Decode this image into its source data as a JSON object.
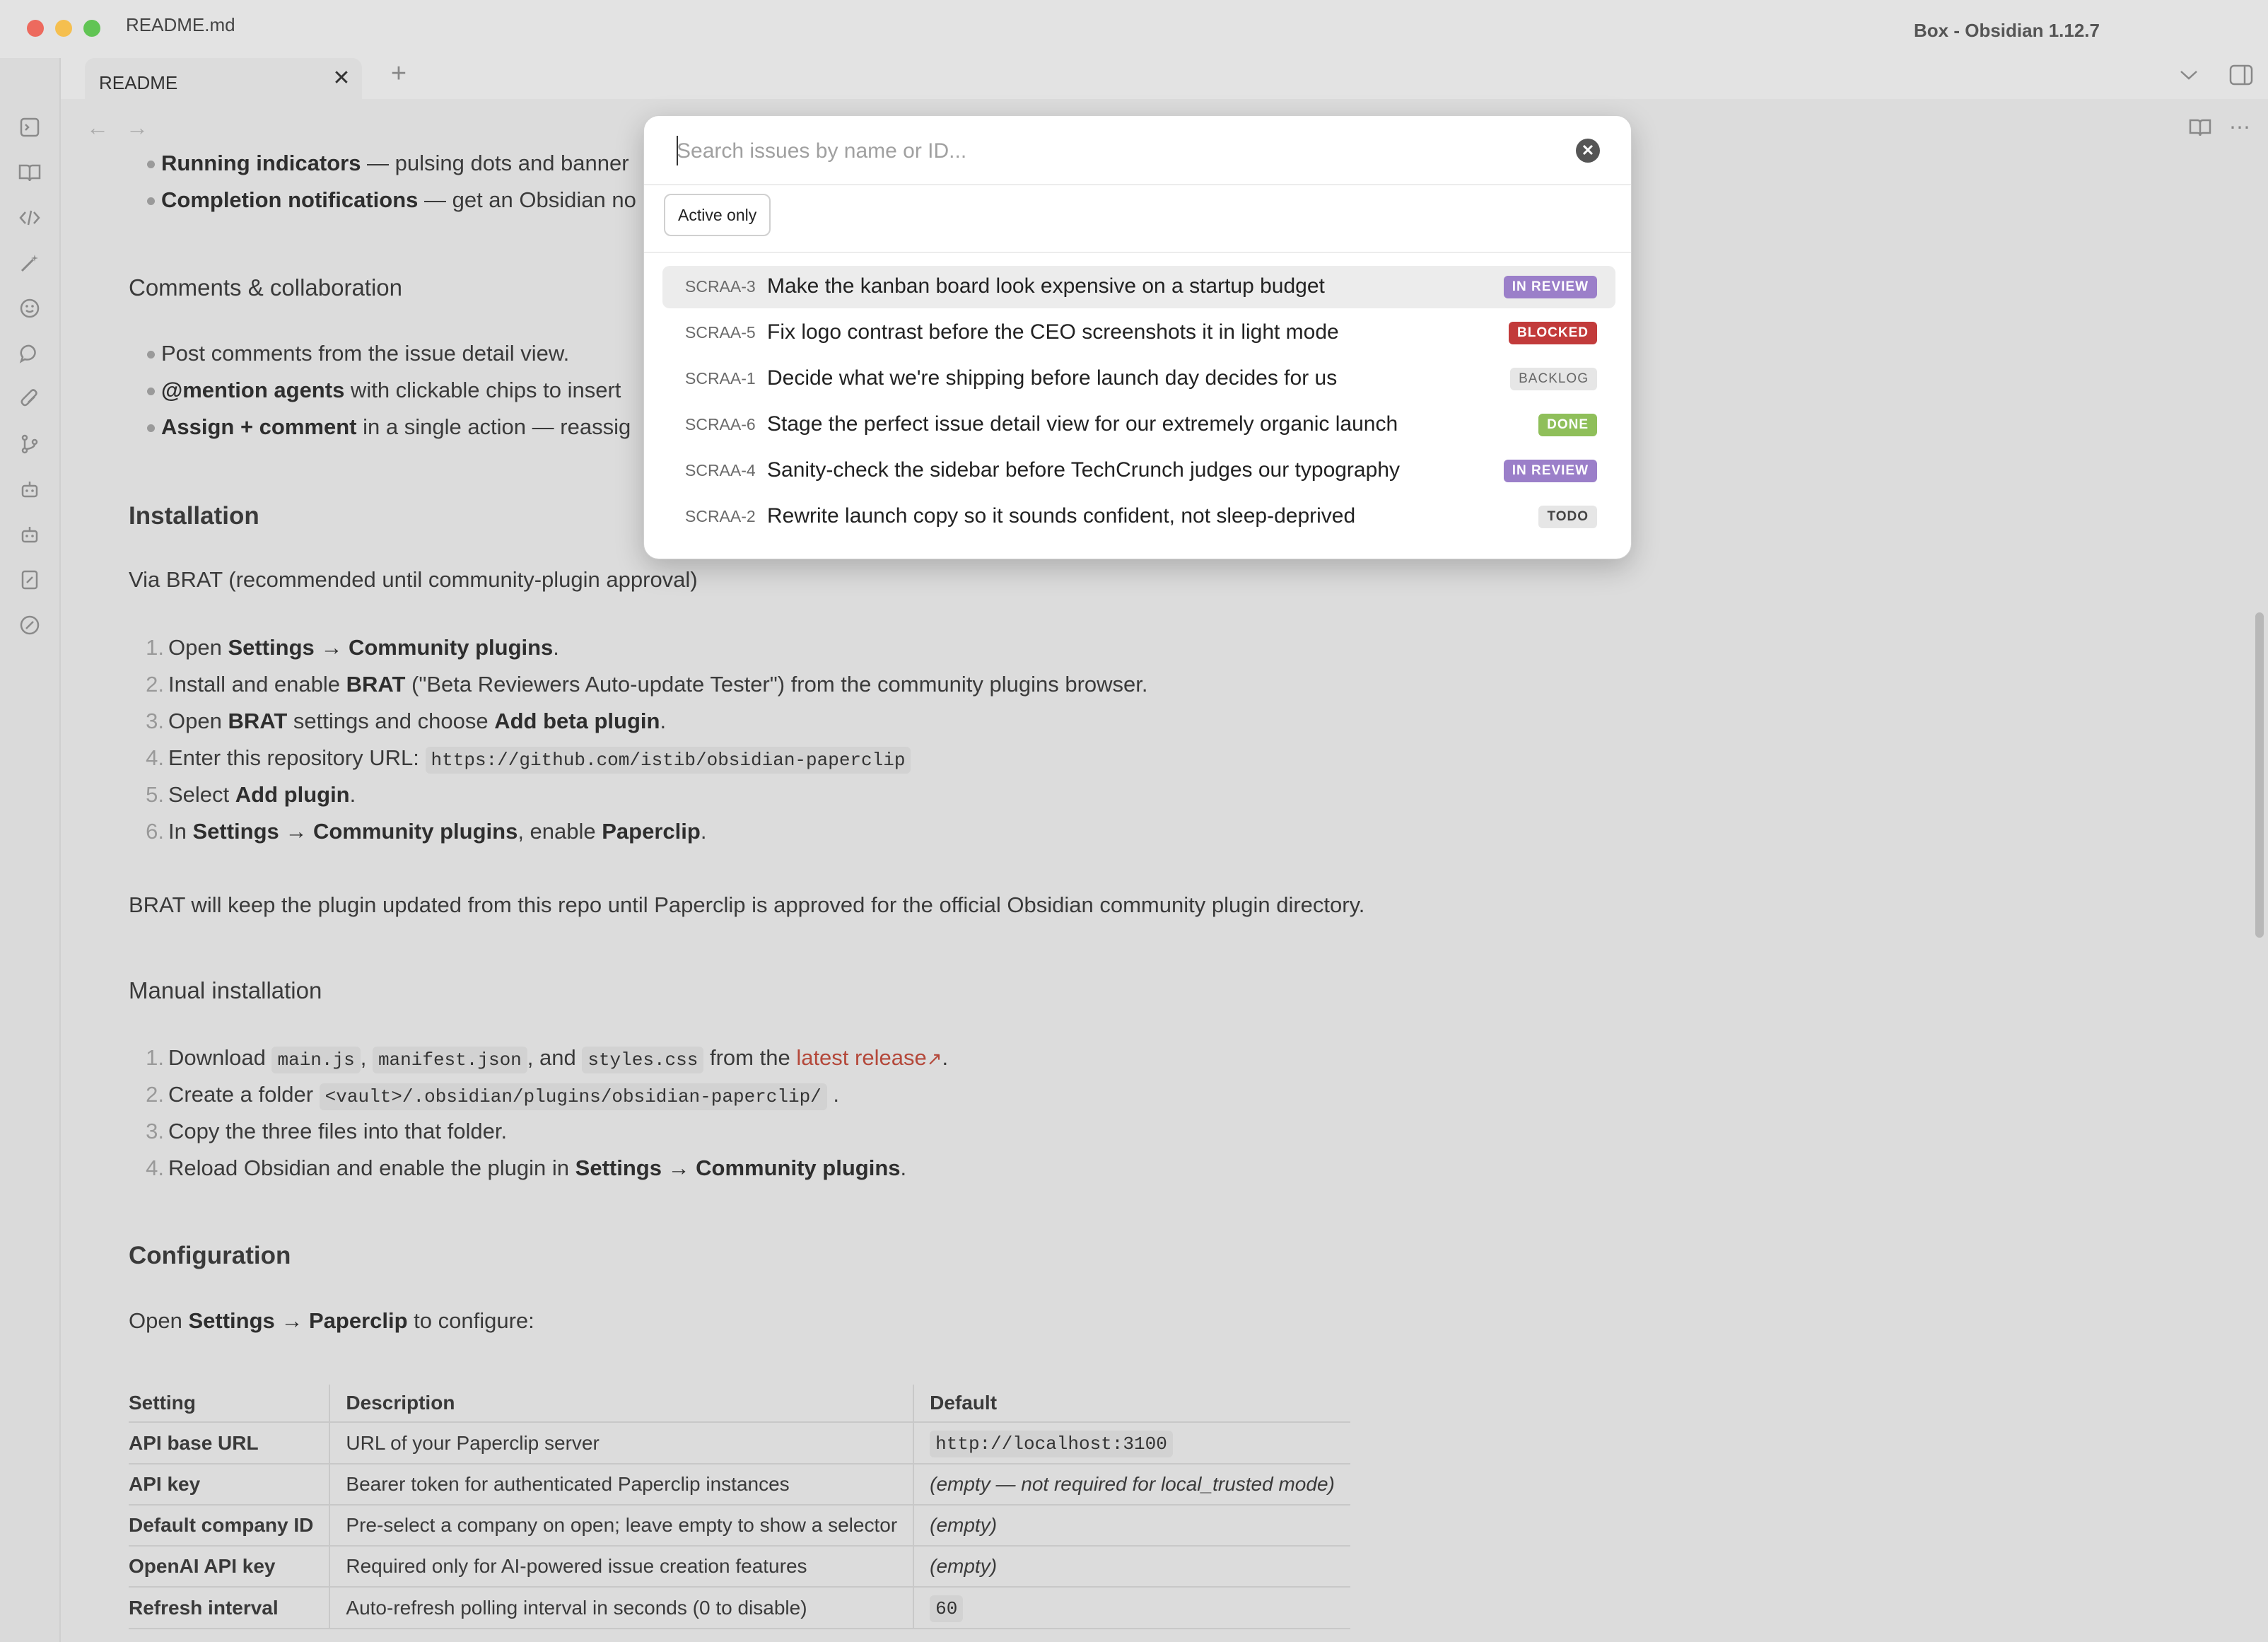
{
  "window": {
    "file_title": "README.md",
    "app_title": "Box - Obsidian 1.12.7"
  },
  "tab": {
    "label": "README",
    "close": "✕",
    "new": "+"
  },
  "doc": {
    "l1_bold": "Running indicators",
    "l1_rest": " — pulsing dots and banner",
    "l2_bold": "Completion notifications",
    "l2_rest": " — get an Obsidian no",
    "h_comments": "Comments & collaboration",
    "c1": "Post comments from the issue detail view.",
    "c2_bold": "@mention agents",
    "c2_rest": " with clickable chips to insert",
    "c3_bold": "Assign + comment",
    "c3_rest": " in a single action — reassig",
    "h_install": "Installation",
    "via_brat": "Via BRAT (recommended until community-plugin approval)",
    "s1_a": "Open ",
    "s1_b": "Settings → Community plugins",
    "s1_c": ".",
    "s2_a": "Install and enable ",
    "s2_b": "BRAT",
    "s2_c": " (\"Beta Reviewers Auto-update Tester\") from the community plugins browser.",
    "s3_a": "Open ",
    "s3_b": "BRAT",
    "s3_c": " settings and choose ",
    "s3_d": "Add beta plugin",
    "s3_e": ".",
    "s4_a": "Enter this repository URL: ",
    "s4_code": "https://github.com/istib/obsidian-paperclip",
    "s5_a": "Select ",
    "s5_b": "Add plugin",
    "s5_c": ".",
    "s6_a": "In ",
    "s6_b": "Settings → Community plugins",
    "s6_c": ", enable ",
    "s6_d": "Paperclip",
    "s6_e": ".",
    "brat_note": "BRAT will keep the plugin updated from this repo until Paperclip is approved for the official Obsidian community plugin directory.",
    "h_manual": "Manual installation",
    "m1_a": "Download ",
    "m1_c1": "main.js",
    "m1_s1": ", ",
    "m1_c2": "manifest.json",
    "m1_s2": ", and ",
    "m1_c3": "styles.css",
    "m1_s3": " from the ",
    "m1_link": "latest release",
    "m1_end": ".",
    "m2_a": "Create a folder ",
    "m2_code": "<vault>/.obsidian/plugins/obsidian-paperclip/",
    "m2_end": ".",
    "m3": "Copy the three files into that folder.",
    "m4_a": "Reload Obsidian and enable the plugin in ",
    "m4_b": "Settings → Community plugins",
    "m4_c": ".",
    "h_config": "Configuration",
    "cfg_a": "Open ",
    "cfg_b": "Settings → Paperclip",
    "cfg_c": " to configure:"
  },
  "numbers": [
    "1.",
    "2.",
    "3.",
    "4.",
    "5.",
    "6."
  ],
  "table": {
    "headers": [
      "Setting",
      "Description",
      "Default"
    ],
    "rows": [
      [
        "API base URL",
        "URL of your Paperclip server",
        "http://localhost:3100"
      ],
      [
        "API key",
        "Bearer token for authenticated Paperclip instances",
        "(empty — not required for local_trusted mode)"
      ],
      [
        "Default company ID",
        "Pre-select a company on open; leave empty to show a selector",
        "(empty)"
      ],
      [
        "OpenAI API key",
        "Required only for AI-powered issue creation features",
        "(empty)"
      ],
      [
        "Refresh interval",
        "Auto-refresh polling interval in seconds (0 to disable)",
        "60"
      ]
    ]
  },
  "modal": {
    "search_placeholder": "Search issues by name or ID...",
    "search_value": "",
    "filter_label": "Active only",
    "issues": [
      {
        "id": "SCRAA-3",
        "title": "Make the kanban board look expensive on a startup budget",
        "status": "IN REVIEW"
      },
      {
        "id": "SCRAA-5",
        "title": "Fix logo contrast before the CEO screenshots it in light mode",
        "status": "BLOCKED"
      },
      {
        "id": "SCRAA-1",
        "title": "Decide what we're shipping before launch day decides for us",
        "status": "BACKLOG"
      },
      {
        "id": "SCRAA-6",
        "title": "Stage the perfect issue detail view for our extremely organic launch",
        "status": "DONE"
      },
      {
        "id": "SCRAA-4",
        "title": "Sanity-check the sidebar before TechCrunch judges our typography",
        "status": "IN REVIEW"
      },
      {
        "id": "SCRAA-2",
        "title": "Rewrite launch copy so it sounds confident, not sleep-deprived",
        "status": "TODO"
      }
    ]
  },
  "colors": {
    "in_review": "#9b7fc9",
    "blocked": "#c23b3b",
    "backlog": "#d8d8d8",
    "done": "#8fbf5a",
    "todo": "#dedede",
    "link": "#b4483a"
  }
}
